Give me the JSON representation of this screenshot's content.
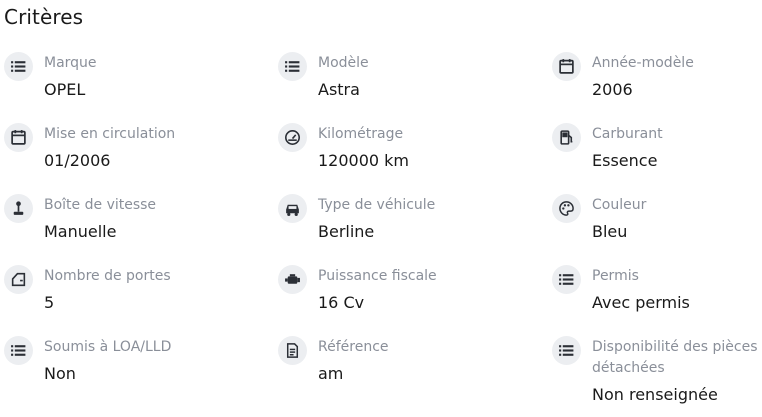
{
  "title": "Critères",
  "criteria": [
    {
      "label": "Marque",
      "value": "OPEL",
      "icon": "list-icon"
    },
    {
      "label": "Modèle",
      "value": "Astra",
      "icon": "list-icon"
    },
    {
      "label": "Année-modèle",
      "value": "2006",
      "icon": "calendar-icon"
    },
    {
      "label": "Mise en circulation",
      "value": "01/2006",
      "icon": "calendar-icon"
    },
    {
      "label": "Kilométrage",
      "value": "120000 km",
      "icon": "speedometer-icon"
    },
    {
      "label": "Carburant",
      "value": "Essence",
      "icon": "fuel-pump-icon"
    },
    {
      "label": "Boîte de vitesse",
      "value": "Manuelle",
      "icon": "gear-stick-icon"
    },
    {
      "label": "Type de véhicule",
      "value": "Berline",
      "icon": "car-icon"
    },
    {
      "label": "Couleur",
      "value": "Bleu",
      "icon": "palette-icon"
    },
    {
      "label": "Nombre de portes",
      "value": "5",
      "icon": "car-door-icon"
    },
    {
      "label": "Puissance fiscale",
      "value": "16 Cv",
      "icon": "engine-icon"
    },
    {
      "label": "Permis",
      "value": "Avec permis",
      "icon": "list-icon"
    },
    {
      "label": "Soumis à LOA/LLD",
      "value": "Non",
      "icon": "list-icon"
    },
    {
      "label": "Référence",
      "value": "am",
      "icon": "document-icon"
    },
    {
      "label": "Disponibilité des pièces détachées",
      "value": "Non renseignée",
      "icon": "list-icon"
    }
  ]
}
